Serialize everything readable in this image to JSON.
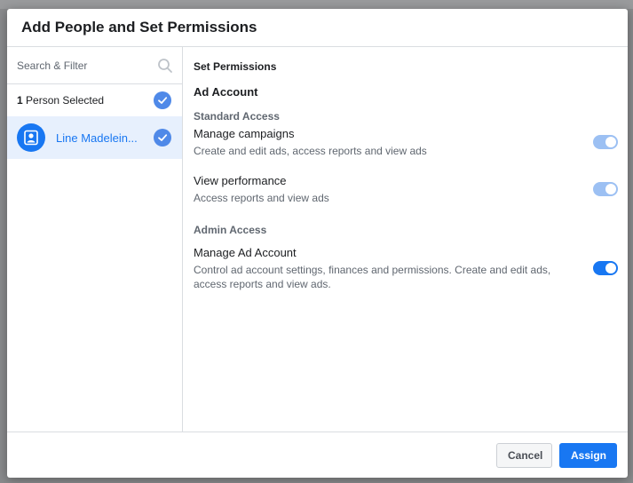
{
  "dialog": {
    "title": "Add People and Set Permissions"
  },
  "left": {
    "search_placeholder": "Search & Filter",
    "selected_count": "1",
    "selected_label": " Person Selected",
    "person_name": "Line Madelein..."
  },
  "right": {
    "section_title": "Set Permissions",
    "account_title": "Ad Account",
    "standard_title": "Standard Access",
    "admin_title": "Admin Access",
    "permissions": [
      {
        "name": "Manage campaigns",
        "desc": "Create and edit ads, access reports and view ads",
        "enabled": true,
        "locked": true
      },
      {
        "name": "View performance",
        "desc": "Access reports and view ads",
        "enabled": true,
        "locked": true
      },
      {
        "name": "Manage Ad Account",
        "desc": "Control ad account settings, finances and permissions. Create and edit ads, access reports and view ads.",
        "enabled": true,
        "locked": false
      }
    ]
  },
  "footer": {
    "cancel_label": "Cancel",
    "assign_label": "Assign"
  },
  "colors": {
    "accent": "#1877f2",
    "check": "#4f89e8",
    "toggle_locked": "#9cc0f3",
    "selected_row_bg": "#e7f0fd"
  },
  "icons": {
    "search": "search-icon",
    "check": "check-circle-icon",
    "avatar": "person-avatar-icon"
  }
}
